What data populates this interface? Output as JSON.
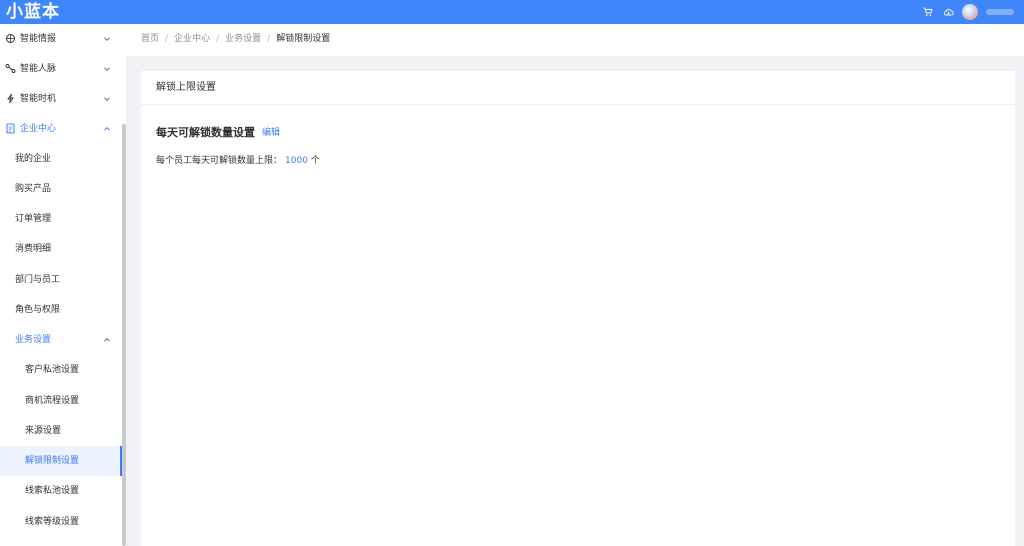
{
  "app": {
    "logo_text": "小蓝本"
  },
  "header": {
    "icons": [
      "cart-icon",
      "cloud-icon"
    ]
  },
  "sidebar": {
    "menus": [
      {
        "label": "智能情报",
        "icon": "radar-icon"
      },
      {
        "label": "智能人脉",
        "icon": "network-icon"
      },
      {
        "label": "智能时机",
        "icon": "lightning-icon"
      },
      {
        "label": "企业中心",
        "icon": "document-icon"
      }
    ],
    "enterprise_items": [
      {
        "label": "我的企业"
      },
      {
        "label": "购买产品"
      },
      {
        "label": "订单管理"
      },
      {
        "label": "消费明细"
      },
      {
        "label": "部门与员工"
      },
      {
        "label": "角色与权限"
      }
    ],
    "business_settings": {
      "label": "业务设置"
    },
    "business_items": [
      {
        "label": "客户私池设置"
      },
      {
        "label": "商机流程设置"
      },
      {
        "label": "来源设置"
      },
      {
        "label": "解锁限制设置"
      },
      {
        "label": "线索私池设置"
      },
      {
        "label": "线索等级设置"
      }
    ]
  },
  "breadcrumb": {
    "items": [
      "首页",
      "企业中心",
      "业务设置",
      "解锁限制设置"
    ],
    "separator": "/"
  },
  "card": {
    "title": "解锁上限设置",
    "section_title": "每天可解锁数量设置",
    "edit_label": "编辑",
    "limit_label": "每个员工每天可解锁数量上限：",
    "limit_value": "1000",
    "limit_unit": "个"
  },
  "colors": {
    "brand": "#3f86fb",
    "accent": "#3a7ef5",
    "selected_bg": "#ecf3ff"
  }
}
